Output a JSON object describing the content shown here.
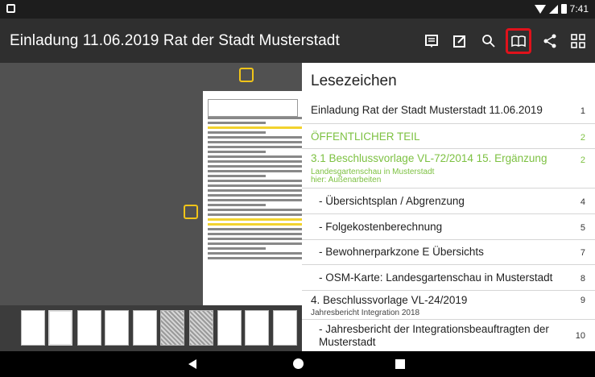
{
  "status_bar": {
    "time": "7:41"
  },
  "app_bar": {
    "title": "Einladung 11.06.2019 Rat der Stadt Musterstadt",
    "actions": [
      "notes-list-icon",
      "edit-icon",
      "search-icon",
      "bookmarks-icon",
      "share-icon",
      "grid-icon"
    ],
    "highlight_color": "#e0121b"
  },
  "bookmarks": {
    "title": "Lesezeichen",
    "accent": "#7dc142",
    "items": [
      {
        "label": "Einladung Rat der Stadt Musterstadt 11.06.2019",
        "page": "1"
      },
      {
        "label": "ÖFFENTLICHER TEIL",
        "page": "2"
      },
      {
        "label": "3.1 Beschlussvorlage VL-72/2014 15. Ergänzung",
        "sub1": "Landesgartenschau in Musterstadt",
        "sub2": "hier: Außenarbeiten",
        "page": "2"
      },
      {
        "label": "- Übersichtsplan / Abgrenzung",
        "page": "4"
      },
      {
        "label": "- Folgekostenberechnung",
        "page": "5"
      },
      {
        "label": "- Bewohnerparkzone E Übersichts",
        "page": "7"
      },
      {
        "label": "- OSM-Karte: Landesgartenschau in Musterstadt",
        "page": "8"
      },
      {
        "label": "4. Beschlussvorlage VL-24/2019",
        "sub1": "Jahresbericht Integration 2018",
        "page": "9"
      },
      {
        "label": "- Jahresbericht der Integrationsbeauftragten der Musterstadt",
        "page": "10"
      }
    ]
  }
}
